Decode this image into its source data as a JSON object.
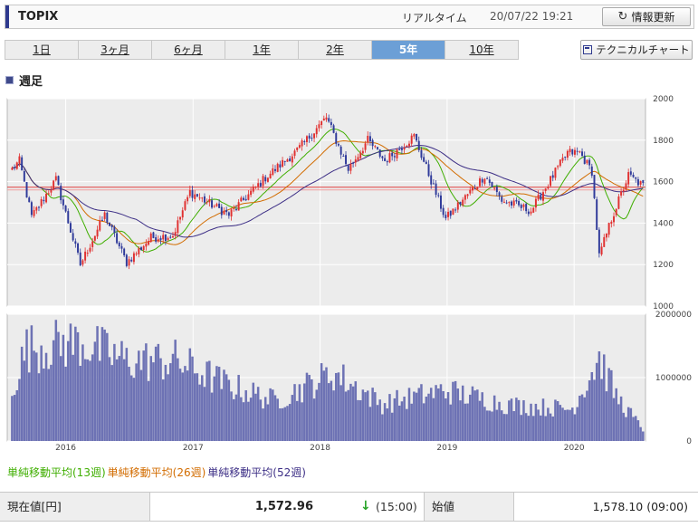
{
  "header": {
    "title": "TOPIX",
    "realtime_label": "リアルタイム",
    "timestamp": "20/07/22 19:21",
    "refresh_label": "情報更新"
  },
  "tabs": [
    {
      "label": "1日",
      "active": false
    },
    {
      "label": "3ヶ月",
      "active": false
    },
    {
      "label": "6ヶ月",
      "active": false
    },
    {
      "label": "1年",
      "active": false
    },
    {
      "label": "2年",
      "active": false
    },
    {
      "label": "5年",
      "active": true
    },
    {
      "label": "10年",
      "active": false
    }
  ],
  "technical_button_label": "テクニカルチャート",
  "section_label": "週足",
  "legend": {
    "ma13": "単純移動平均(13週)",
    "ma26": "単純移動平均(26週)",
    "ma52": "単純移動平均(52週)"
  },
  "colors": {
    "up": "#e03030",
    "down": "#2f3a9a",
    "ma13": "#3fae00",
    "ma26": "#d26c00",
    "ma52": "#3d2f86",
    "volume": "#6d72b4",
    "grid": "#ffffff",
    "plot_bg": "#ececec",
    "current_line": "#e04040"
  },
  "quote": {
    "current_label": "現在値[円]",
    "current_value": "1,572.96",
    "arrow": "↓",
    "current_time": "(15:00)",
    "open_label": "始値",
    "open_value": "1,578.10 (09:00)"
  },
  "chart_data": [
    {
      "type": "candlestick",
      "title": "",
      "ylim": [
        1000,
        2000
      ],
      "yticks": [
        "2000",
        "1800",
        "1600",
        "1400",
        "1200",
        "1000"
      ],
      "xticks": [
        "2016",
        "2017",
        "2018",
        "2019",
        "2020"
      ],
      "current_price_line": 1572.96,
      "weekly_close_keypoints": [
        {
          "date": "2015-07-31",
          "value": 1660
        },
        {
          "date": "2015-08-21",
          "value": 1700
        },
        {
          "date": "2015-09-25",
          "value": 1430
        },
        {
          "date": "2015-12-04",
          "value": 1610
        },
        {
          "date": "2016-02-12",
          "value": 1200
        },
        {
          "date": "2016-04-22",
          "value": 1440
        },
        {
          "date": "2016-06-24",
          "value": 1210
        },
        {
          "date": "2016-09-02",
          "value": 1330
        },
        {
          "date": "2016-11-04",
          "value": 1340
        },
        {
          "date": "2016-12-23",
          "value": 1550
        },
        {
          "date": "2017-04-14",
          "value": 1440
        },
        {
          "date": "2017-07-28",
          "value": 1620
        },
        {
          "date": "2017-10-27",
          "value": 1750
        },
        {
          "date": "2018-01-19",
          "value": 1910
        },
        {
          "date": "2018-03-23",
          "value": 1660
        },
        {
          "date": "2018-05-18",
          "value": 1800
        },
        {
          "date": "2018-07-06",
          "value": 1700
        },
        {
          "date": "2018-09-28",
          "value": 1820
        },
        {
          "date": "2018-12-28",
          "value": 1420
        },
        {
          "date": "2019-04-19",
          "value": 1630
        },
        {
          "date": "2019-06-07",
          "value": 1510
        },
        {
          "date": "2019-08-30",
          "value": 1460
        },
        {
          "date": "2019-12-13",
          "value": 1740
        },
        {
          "date": "2020-01-17",
          "value": 1740
        },
        {
          "date": "2020-02-21",
          "value": 1650
        },
        {
          "date": "2020-03-13",
          "value": 1240
        },
        {
          "date": "2020-04-17",
          "value": 1420
        },
        {
          "date": "2020-06-05",
          "value": 1630
        },
        {
          "date": "2020-07-22",
          "value": 1573
        }
      ]
    },
    {
      "type": "bar",
      "title": "",
      "ylim": [
        0,
        2000000
      ],
      "yticks": [
        "2000000",
        "1000000",
        "0"
      ],
      "xticks": [
        "2016",
        "2017",
        "2018",
        "2019",
        "2020"
      ],
      "volume_keypoints": [
        {
          "date": "2015-07-31",
          "value": 850000
        },
        {
          "date": "2015-09-11",
          "value": 1500000
        },
        {
          "date": "2016-02-12",
          "value": 1600000
        },
        {
          "date": "2016-06-24",
          "value": 1300000
        },
        {
          "date": "2016-11-11",
          "value": 1300000
        },
        {
          "date": "2017-04-14",
          "value": 900000
        },
        {
          "date": "2017-08-25",
          "value": 650000
        },
        {
          "date": "2018-02-09",
          "value": 1100000
        },
        {
          "date": "2018-06-29",
          "value": 600000
        },
        {
          "date": "2018-12-28",
          "value": 820000
        },
        {
          "date": "2019-06-28",
          "value": 580000
        },
        {
          "date": "2019-12-27",
          "value": 520000
        },
        {
          "date": "2020-03-13",
          "value": 1350000
        },
        {
          "date": "2020-05-01",
          "value": 720000
        },
        {
          "date": "2020-07-22",
          "value": 150000
        }
      ]
    }
  ]
}
